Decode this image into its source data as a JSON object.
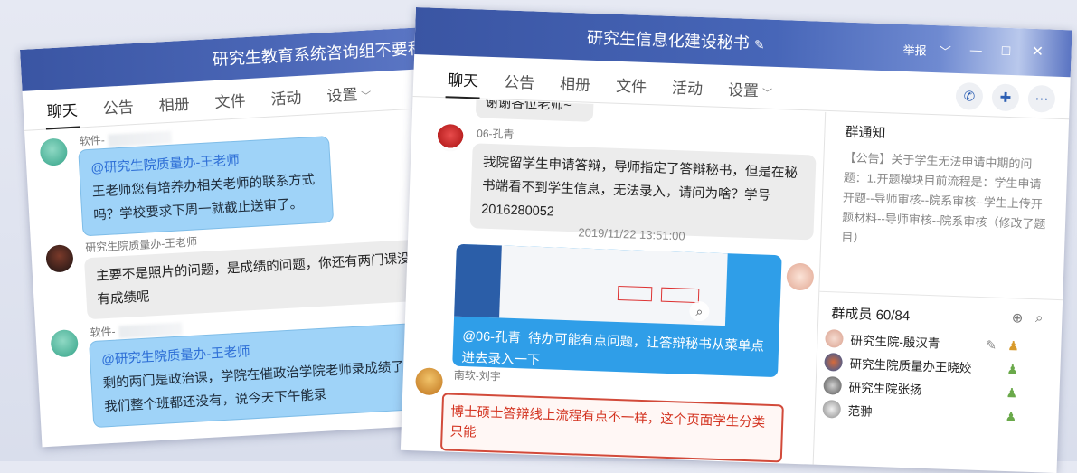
{
  "left_window": {
    "title": "研究生教育系统咨询组不要私聊",
    "tabs": [
      "聊天",
      "公告",
      "相册",
      "文件",
      "活动",
      "设置"
    ],
    "messages": [
      {
        "sender": "软件-",
        "at": "@研究生院质量办-王老师",
        "text": "王老师您有培养办相关老师的联系方式吗？学校要求下周一就截止送审了。"
      },
      {
        "sender": "研究生院质量办-王老师",
        "text": "主要不是照片的问题，是成绩的问题，你还有两门课没有成绩呢"
      },
      {
        "sender": "软件-",
        "at": "@研究生院质量办-王老师",
        "text": "剩的两门是政治课，学院在催政治学院老师录成绩了，我们整个班都还没有，说今天下午能录"
      }
    ]
  },
  "right_window": {
    "title": "研究生信息化建设秘书",
    "edit_icon": "pencil-icon",
    "report_label": "举报",
    "tabs": [
      "聊天",
      "公告",
      "相册",
      "文件",
      "活动",
      "设置"
    ],
    "prev_fragment": "谢谢各位老师~",
    "messages": [
      {
        "sender": "06-孔青",
        "text": "我院留学生申请答辩，导师指定了答辩秘书，但是在秘书端看不到学生信息，无法录入，请问为啥？学号2016280052"
      }
    ],
    "timestamp": "2019/11/22 13:51:00",
    "reply": {
      "at": "@06-孔青",
      "text": "待办可能有点问题，让答辩秘书从菜单点进去录入一下"
    },
    "last": {
      "sender": "南软-刘宇",
      "text": "博士硕士答辩线上流程有点不一样，这个页面学生分类只能"
    },
    "notice": {
      "title": "群通知",
      "tag": "【公告】",
      "text": "关于学生无法申请中期的问题：1.开题模块目前流程是：学生申请开题--导师审核--院系审核--学生上传开题材料--导师审核--院系审核（修改了题目）"
    },
    "members": {
      "label": "群成员 60/84",
      "list": [
        "研究生院-殷汉青",
        "研究生院质量办王晓姣",
        "研究生院张扬",
        "范翀"
      ]
    },
    "colors": {
      "accent": "#3a55a3",
      "bubble_blue": "#2f9ee8"
    }
  }
}
